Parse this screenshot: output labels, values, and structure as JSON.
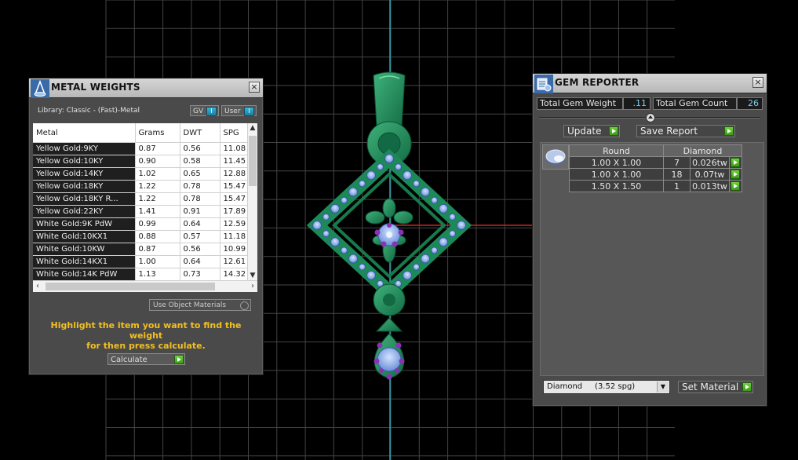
{
  "metal_weights": {
    "title": "METAL WEIGHTS",
    "library_label": "Library: Classic - (Fast)-Metal",
    "toggles": [
      {
        "label": "GV",
        "state": "I"
      },
      {
        "label": "User",
        "state": "I"
      }
    ],
    "columns": [
      "Metal",
      "Grams",
      "DWT",
      "SPG"
    ],
    "rows": [
      [
        "Yellow Gold:9KY",
        "0.87",
        "0.56",
        "11.08"
      ],
      [
        "Yellow Gold:10KY",
        "0.90",
        "0.58",
        "11.45"
      ],
      [
        "Yellow Gold:14KY",
        "1.02",
        "0.65",
        "12.88"
      ],
      [
        "Yellow Gold:18KY",
        "1.22",
        "0.78",
        "15.47"
      ],
      [
        "Yellow Gold:18KY R...",
        "1.22",
        "0.78",
        "15.47"
      ],
      [
        "Yellow Gold:22KY",
        "1.41",
        "0.91",
        "17.89"
      ],
      [
        "White Gold:9K PdW",
        "0.99",
        "0.64",
        "12.59"
      ],
      [
        "White Gold:10KX1",
        "0.88",
        "0.57",
        "11.18"
      ],
      [
        "White Gold:10KW",
        "0.87",
        "0.56",
        "10.99"
      ],
      [
        "White Gold:14KX1",
        "1.00",
        "0.64",
        "12.61"
      ],
      [
        "White Gold:14K PdW",
        "1.13",
        "0.73",
        "14.32"
      ]
    ],
    "use_object_materials": "Use Object Materials",
    "hint_line1": "Highlight the item you want to find the weight",
    "hint_line2": "for then press calculate.",
    "calculate_label": "Calculate"
  },
  "gem_reporter": {
    "title": "GEM REPORTER",
    "total_weight_label": "Total Gem Weight",
    "total_weight_value": ".11",
    "total_count_label": "Total Gem Count",
    "total_count_value": "26",
    "update_label": "Update",
    "save_report_label": "Save Report",
    "table_headers": [
      "Round",
      "Diamond"
    ],
    "rows": [
      {
        "size": "1.00 X 1.00",
        "count": "7",
        "weight": "0.026tw"
      },
      {
        "size": "1.00 X 1.00",
        "count": "18",
        "weight": "0.07tw"
      },
      {
        "size": "1.50 X 1.50",
        "count": "1",
        "weight": "0.013tw"
      }
    ],
    "material_select": "Diamond     (3.52 spg)",
    "set_material_label": "Set Material"
  },
  "colors": {
    "viewport_bg": "#000000",
    "grid": "#4a4a4a",
    "model_green": "#1f8a5c",
    "model_stone": "#8fb3f0",
    "axis_red": "#cc2222",
    "axis_cyan": "#2aa6b8",
    "hint_yellow": "#f2c021",
    "accent_green": "#5cc22c"
  }
}
